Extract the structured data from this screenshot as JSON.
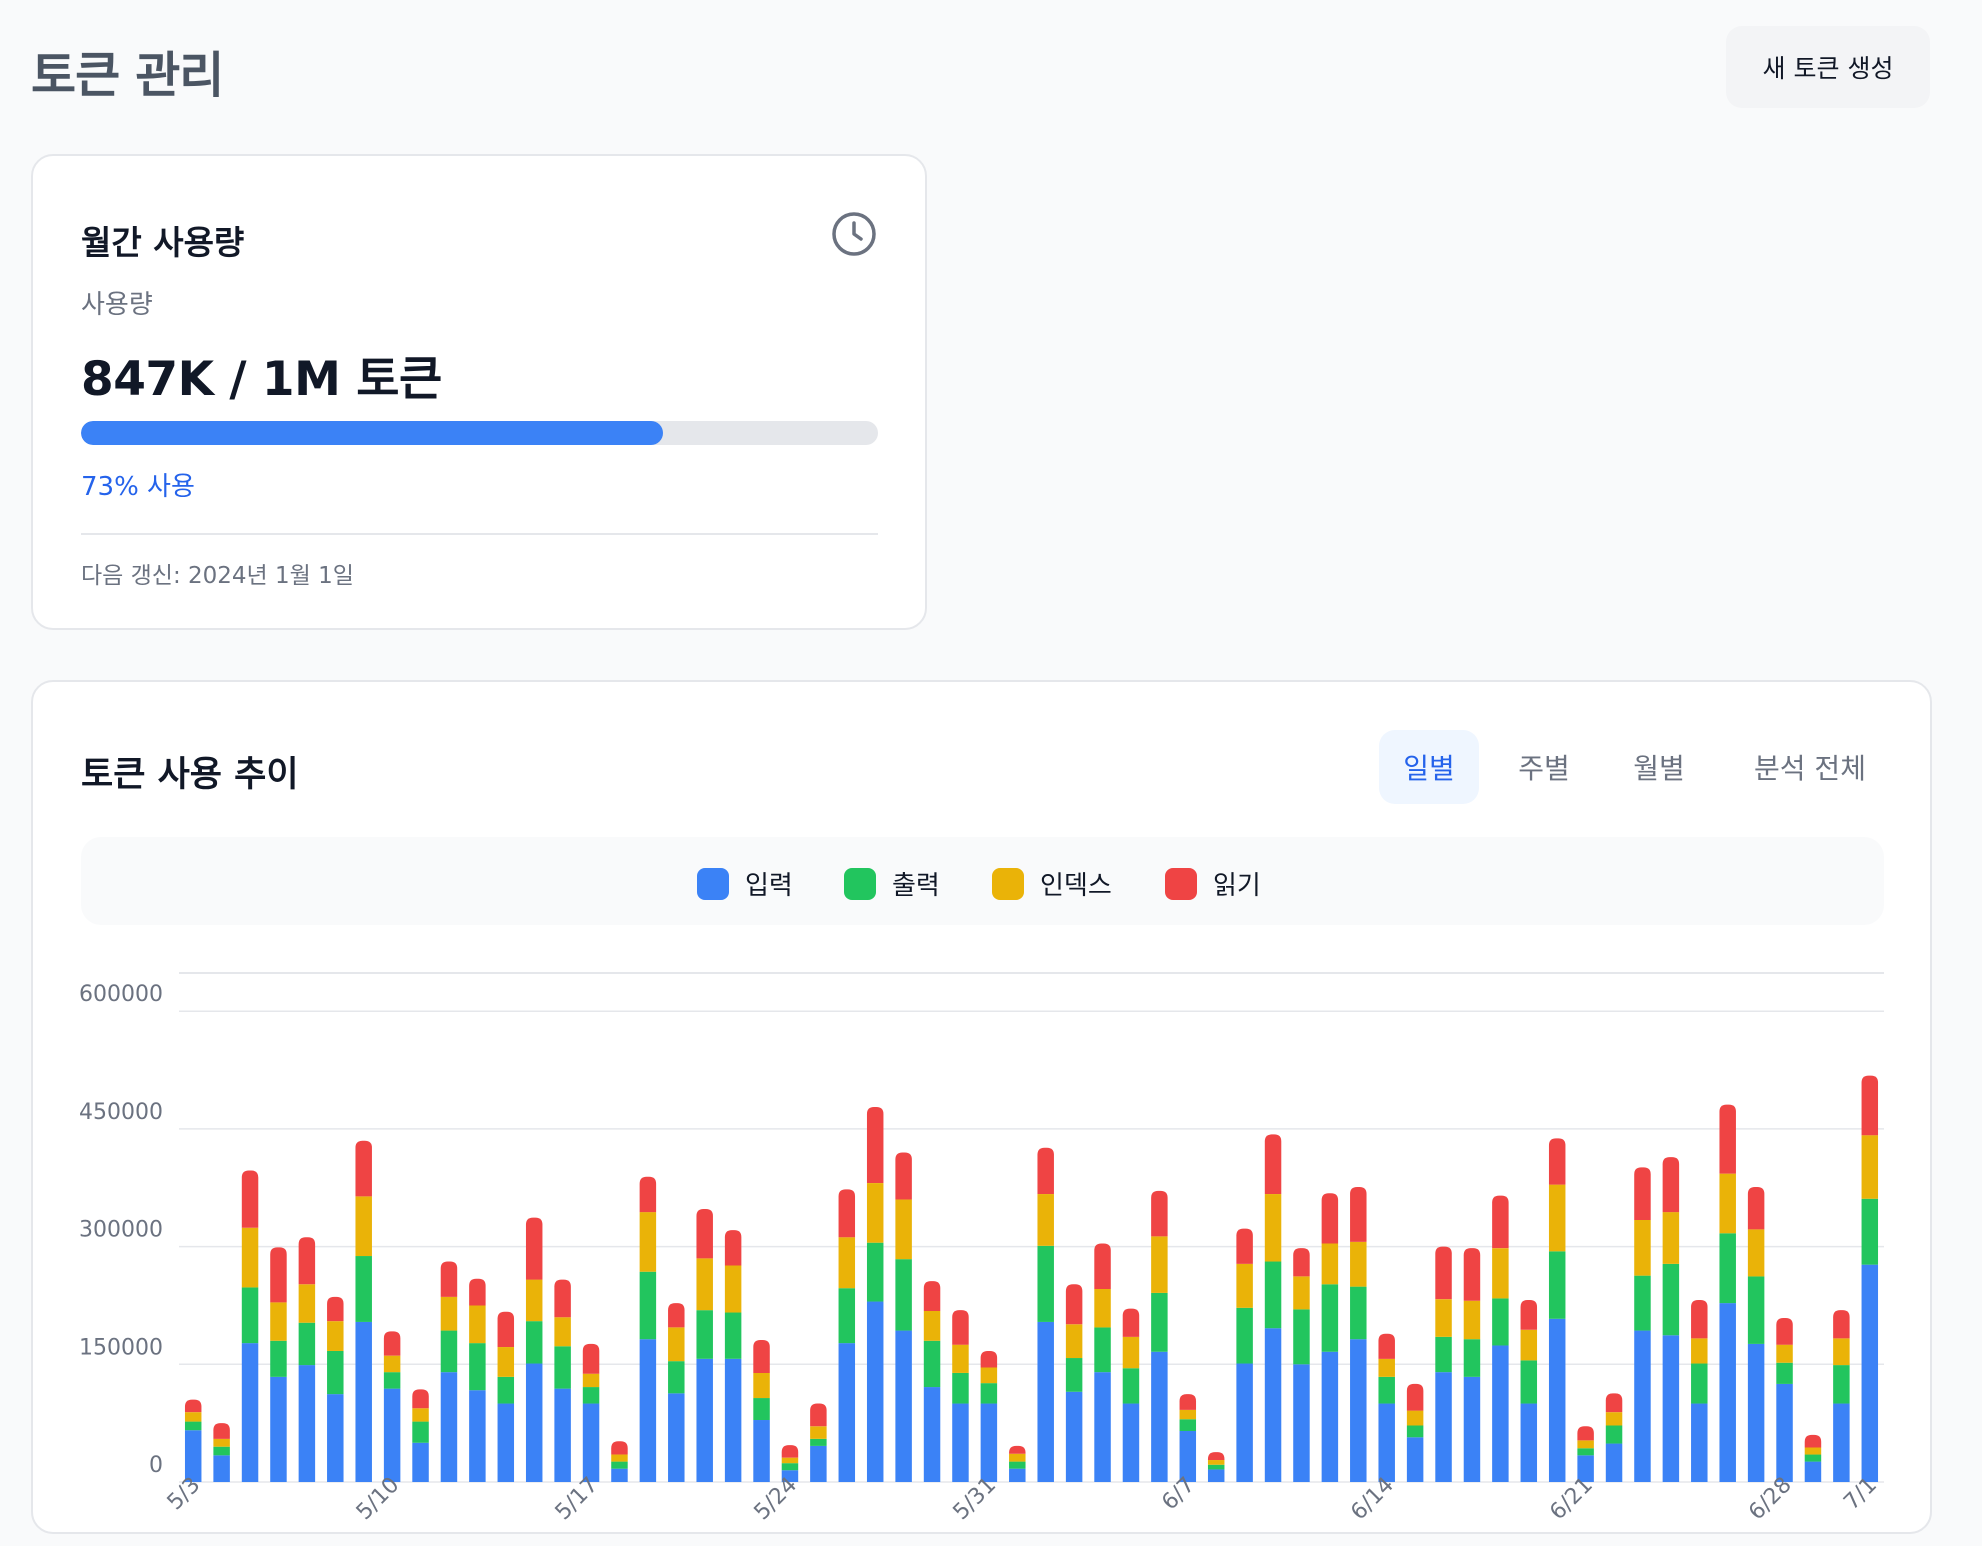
{
  "header": {
    "title": "토큰 관리",
    "new_token_label": "새 토큰 생성"
  },
  "usage_card": {
    "title": "월간 사용량",
    "label": "사용량",
    "value": "847K / 1M 토큰",
    "percent": 73,
    "percent_text": "73% 사용",
    "renewal": "다음 갱신: 2024년 1월 1일",
    "icon": "clock-icon"
  },
  "trend_card": {
    "title": "토큰 사용 추이",
    "tabs": [
      {
        "label": "일별",
        "active": true
      },
      {
        "label": "주별",
        "active": false
      },
      {
        "label": "월별",
        "active": false
      },
      {
        "label": "분석 전체",
        "active": false
      }
    ]
  },
  "colors": {
    "입력": "#3b82f6",
    "출력": "#22c55e",
    "인덱스": "#eab308",
    "읽기": "#ef4444",
    "accent": "#3b82f6"
  },
  "chart_data": {
    "type": "bar",
    "stacked": true,
    "legend_position": "top-center",
    "grid": true,
    "ylim": [
      0,
      650000
    ],
    "yticks": [
      0,
      150000,
      300000,
      450000,
      600000
    ],
    "xtick_labels": [
      "5/3",
      "5/10",
      "5/17",
      "5/24",
      "5/31",
      "6/7",
      "6/14",
      "6/21",
      "6/28",
      "7/1"
    ],
    "categories": [
      "5/3",
      "5/4",
      "5/5",
      "5/6",
      "5/7",
      "5/8",
      "5/9",
      "5/10",
      "5/11",
      "5/12",
      "5/13",
      "5/14",
      "5/15",
      "5/16",
      "5/17",
      "5/18",
      "5/19",
      "5/20",
      "5/21",
      "5/22",
      "5/23",
      "5/24",
      "5/25",
      "5/26",
      "5/27",
      "5/28",
      "5/29",
      "5/30",
      "5/31",
      "6/1",
      "6/2",
      "6/3",
      "6/4",
      "6/5",
      "6/6",
      "6/7",
      "6/8",
      "6/9",
      "6/10",
      "6/11",
      "6/12",
      "6/13",
      "6/14",
      "6/15",
      "6/16",
      "6/17",
      "6/18",
      "6/19",
      "6/20",
      "6/21",
      "6/22",
      "6/23",
      "6/24",
      "6/25",
      "6/26",
      "6/27",
      "6/28",
      "6/29",
      "6/30",
      "7/1"
    ],
    "series": [
      {
        "name": "입력",
        "values": [
          66000,
          34000,
          177000,
          134000,
          149000,
          112000,
          204000,
          119000,
          50000,
          140000,
          117000,
          100000,
          151000,
          119000,
          100000,
          17000,
          182000,
          113000,
          157000,
          157000,
          79000,
          15000,
          46000,
          177000,
          230000,
          193000,
          121000,
          100000,
          100000,
          17000,
          204000,
          115000,
          140000,
          100000,
          166000,
          65000,
          16000,
          151000,
          196000,
          150000,
          166000,
          182000,
          100000,
          57000,
          140000,
          134000,
          174000,
          100000,
          208000,
          34000,
          49000,
          193000,
          187000,
          100000,
          228000,
          176000,
          125000,
          26000,
          100000,
          277000
        ]
      },
      {
        "name": "출력",
        "values": [
          11000,
          11000,
          71000,
          46000,
          54000,
          55000,
          84000,
          21000,
          27000,
          53000,
          60000,
          34000,
          54000,
          54000,
          21000,
          9000,
          86000,
          41000,
          62000,
          59000,
          28000,
          9000,
          9000,
          70000,
          75000,
          91000,
          59000,
          39000,
          26000,
          9000,
          97000,
          43000,
          57000,
          45000,
          75000,
          15000,
          6000,
          71000,
          85000,
          70000,
          86000,
          67000,
          34000,
          15000,
          45000,
          48000,
          60000,
          55000,
          86000,
          9000,
          23000,
          70000,
          91000,
          51000,
          89000,
          86000,
          27000,
          9000,
          49000,
          84000
        ]
      },
      {
        "name": "인덱스",
        "values": [
          12000,
          10000,
          76000,
          49000,
          49000,
          38000,
          76000,
          21000,
          17000,
          43000,
          48000,
          38000,
          53000,
          37000,
          17000,
          9000,
          76000,
          43000,
          66000,
          60000,
          32000,
          7000,
          16000,
          65000,
          76000,
          76000,
          38000,
          36000,
          20000,
          10000,
          66000,
          43000,
          49000,
          40000,
          72000,
          12000,
          6000,
          56000,
          86000,
          42000,
          52000,
          57000,
          23000,
          19000,
          48000,
          49000,
          64000,
          39000,
          85000,
          10000,
          17000,
          71000,
          66000,
          32000,
          76000,
          60000,
          23000,
          9000,
          34000,
          81000
        ]
      },
      {
        "name": "읽기",
        "values": [
          16000,
          20000,
          73000,
          70000,
          60000,
          31000,
          71000,
          31000,
          24000,
          45000,
          34000,
          45000,
          79000,
          48000,
          38000,
          17000,
          45000,
          31000,
          63000,
          45000,
          42000,
          16000,
          29000,
          61000,
          97000,
          60000,
          38000,
          44000,
          21000,
          10000,
          59000,
          51000,
          58000,
          36000,
          58000,
          20000,
          10000,
          45000,
          76000,
          36000,
          64000,
          70000,
          32000,
          34000,
          67000,
          67000,
          67000,
          38000,
          59000,
          18000,
          24000,
          67000,
          70000,
          49000,
          88000,
          54000,
          34000,
          16000,
          36000,
          76000
        ]
      }
    ]
  }
}
